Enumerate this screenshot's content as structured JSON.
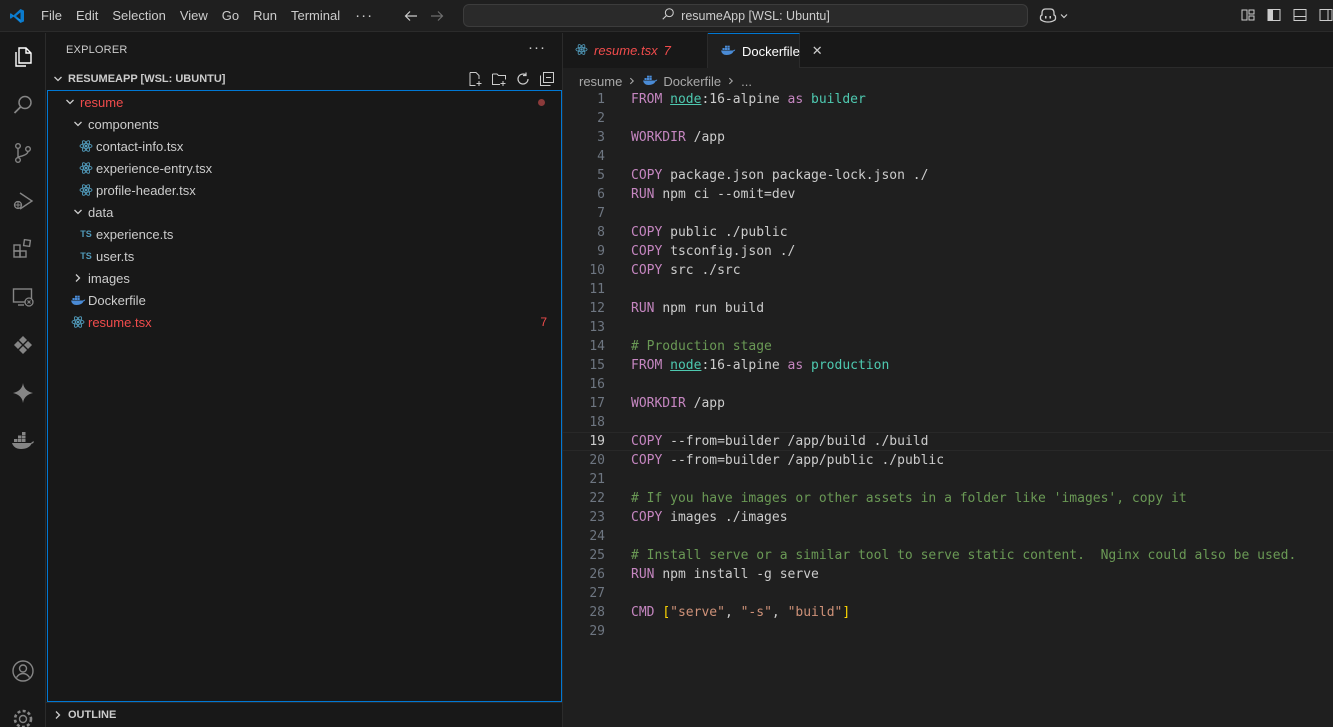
{
  "titlebar": {
    "menu": [
      "File",
      "Edit",
      "Selection",
      "View",
      "Go",
      "Run",
      "Terminal"
    ],
    "more": "···",
    "search_text": "resumeApp [WSL: Ubuntu]"
  },
  "activity_bar": {
    "items": [
      "explorer",
      "search",
      "source-control",
      "run-and-debug",
      "extensions",
      "remote-explorer",
      "remote-extension",
      "copilot",
      "docker",
      "accounts",
      "manage"
    ]
  },
  "sidebar": {
    "title": "EXPLORER",
    "more": "···",
    "workspace": "RESUMEAPP [WSL: UBUNTU]",
    "tree": [
      {
        "label": "resume",
        "type": "folder",
        "expanded": true,
        "depth": 0,
        "error": true
      },
      {
        "label": "components",
        "type": "folder",
        "expanded": true,
        "depth": 1
      },
      {
        "label": "contact-info.tsx",
        "type": "react",
        "depth": 2
      },
      {
        "label": "experience-entry.tsx",
        "type": "react",
        "depth": 2
      },
      {
        "label": "profile-header.tsx",
        "type": "react",
        "depth": 2
      },
      {
        "label": "data",
        "type": "folder",
        "expanded": true,
        "depth": 1
      },
      {
        "label": "experience.ts",
        "type": "ts",
        "depth": 2
      },
      {
        "label": "user.ts",
        "type": "ts",
        "depth": 2
      },
      {
        "label": "images",
        "type": "folder",
        "expanded": false,
        "depth": 1
      },
      {
        "label": "Dockerfile",
        "type": "docker",
        "depth": 1
      },
      {
        "label": "resume.tsx",
        "type": "react",
        "depth": 1,
        "error": true,
        "badge": "7"
      }
    ],
    "ts_badge": "TS",
    "outline_label": "OUTLINE"
  },
  "editor": {
    "tabs": [
      {
        "label": "resume.tsx",
        "badge": "7",
        "active": false
      },
      {
        "label": "Dockerfile",
        "active": true,
        "close": "✕"
      }
    ],
    "breadcrumb": [
      "resume",
      "Dockerfile",
      "..."
    ],
    "current_line": 19,
    "lines": [
      {
        "n": "1",
        "tokens": [
          {
            "t": "FROM ",
            "c": "kw"
          },
          {
            "t": "node",
            "c": "img"
          },
          {
            "t": ":16-alpine ",
            "c": "plain"
          },
          {
            "t": "as ",
            "c": "kw"
          },
          {
            "t": "builder",
            "c": "stage"
          }
        ]
      },
      {
        "n": "2",
        "tokens": []
      },
      {
        "n": "3",
        "tokens": [
          {
            "t": "WORKDIR ",
            "c": "kw"
          },
          {
            "t": "/app",
            "c": "plain"
          }
        ]
      },
      {
        "n": "4",
        "tokens": []
      },
      {
        "n": "5",
        "tokens": [
          {
            "t": "COPY ",
            "c": "kw"
          },
          {
            "t": "package.json package-lock.json ./",
            "c": "plain"
          }
        ]
      },
      {
        "n": "6",
        "tokens": [
          {
            "t": "RUN ",
            "c": "kw"
          },
          {
            "t": "npm ci --omit=dev",
            "c": "plain"
          }
        ]
      },
      {
        "n": "7",
        "tokens": []
      },
      {
        "n": "8",
        "tokens": [
          {
            "t": "COPY ",
            "c": "kw"
          },
          {
            "t": "public ./public",
            "c": "plain"
          }
        ]
      },
      {
        "n": "9",
        "tokens": [
          {
            "t": "COPY ",
            "c": "kw"
          },
          {
            "t": "tsconfig.json ./",
            "c": "plain"
          }
        ]
      },
      {
        "n": "10",
        "tokens": [
          {
            "t": "COPY ",
            "c": "kw"
          },
          {
            "t": "src ./src",
            "c": "plain"
          }
        ]
      },
      {
        "n": "11",
        "tokens": []
      },
      {
        "n": "12",
        "tokens": [
          {
            "t": "RUN ",
            "c": "kw"
          },
          {
            "t": "npm run build",
            "c": "plain"
          }
        ]
      },
      {
        "n": "13",
        "tokens": []
      },
      {
        "n": "14",
        "tokens": [
          {
            "t": "# Production stage",
            "c": "cm"
          }
        ]
      },
      {
        "n": "15",
        "tokens": [
          {
            "t": "FROM ",
            "c": "kw"
          },
          {
            "t": "node",
            "c": "img"
          },
          {
            "t": ":16-alpine ",
            "c": "plain"
          },
          {
            "t": "as ",
            "c": "kw"
          },
          {
            "t": "production",
            "c": "stage"
          }
        ]
      },
      {
        "n": "16",
        "tokens": []
      },
      {
        "n": "17",
        "tokens": [
          {
            "t": "WORKDIR ",
            "c": "kw"
          },
          {
            "t": "/app",
            "c": "plain"
          }
        ]
      },
      {
        "n": "18",
        "tokens": []
      },
      {
        "n": "19",
        "tokens": [
          {
            "t": "COPY ",
            "c": "kw"
          },
          {
            "t": "--from=builder /app/build ./build",
            "c": "plain"
          }
        ]
      },
      {
        "n": "20",
        "tokens": [
          {
            "t": "COPY ",
            "c": "kw"
          },
          {
            "t": "--from=builder /app/public ./public",
            "c": "plain"
          }
        ]
      },
      {
        "n": "21",
        "tokens": []
      },
      {
        "n": "22",
        "tokens": [
          {
            "t": "# If you have images or other assets in a folder like 'images', copy it",
            "c": "cm"
          }
        ]
      },
      {
        "n": "23",
        "tokens": [
          {
            "t": "COPY ",
            "c": "kw"
          },
          {
            "t": "images ./images",
            "c": "plain"
          }
        ]
      },
      {
        "n": "24",
        "tokens": []
      },
      {
        "n": "25",
        "tokens": [
          {
            "t": "# Install serve or a similar tool to serve static content.  Nginx could also be used.",
            "c": "cm"
          }
        ]
      },
      {
        "n": "26",
        "tokens": [
          {
            "t": "RUN ",
            "c": "kw"
          },
          {
            "t": "npm install -g serve",
            "c": "plain"
          }
        ]
      },
      {
        "n": "27",
        "tokens": []
      },
      {
        "n": "28",
        "tokens": [
          {
            "t": "CMD ",
            "c": "kw"
          },
          {
            "t": "[",
            "c": "br"
          },
          {
            "t": "\"serve\"",
            "c": "str"
          },
          {
            "t": ", ",
            "c": "plain"
          },
          {
            "t": "\"-s\"",
            "c": "str"
          },
          {
            "t": ", ",
            "c": "plain"
          },
          {
            "t": "\"build\"",
            "c": "str"
          },
          {
            "t": "]",
            "c": "br"
          }
        ]
      },
      {
        "n": "29",
        "tokens": []
      }
    ]
  },
  "colors": {
    "accent": "#0078d4",
    "error": "#f14c4c",
    "keyword": "#c586c0",
    "comment": "#6a9955",
    "string": "#ce9178",
    "type": "#4ec9b0"
  }
}
